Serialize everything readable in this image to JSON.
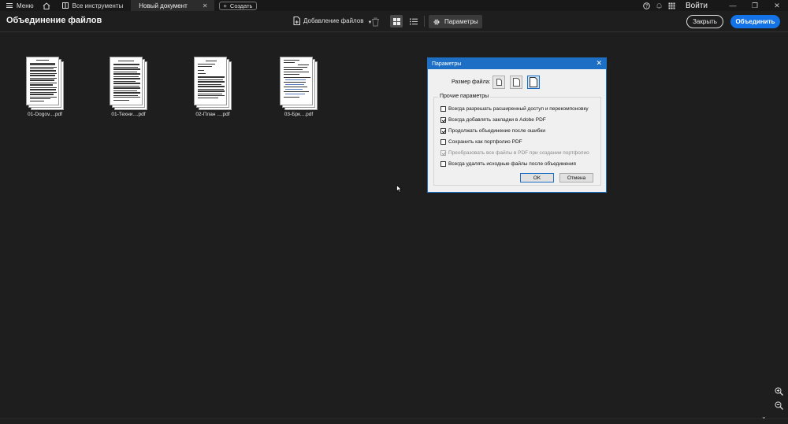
{
  "tabbar": {
    "menu_label": "Меню",
    "tabs": [
      {
        "label": "Все инструменты"
      },
      {
        "label": "Новый документ"
      }
    ],
    "new_label": "Создать",
    "signin_label": "Войти"
  },
  "toolbar": {
    "title": "Объединение файлов",
    "add_files_label": "Добавление файлов",
    "params_label": "Параметры",
    "close_label": "Закрыть",
    "merge_label": "Объединить"
  },
  "files": [
    {
      "name": "01-Dogov....pdf"
    },
    {
      "name": "01-Техни....pdf"
    },
    {
      "name": "02-План ....pdf"
    },
    {
      "name": "03-Брк....pdf"
    }
  ],
  "dialog": {
    "title": "Параметры",
    "file_size_label": "Размер файла:",
    "selected_size": "large",
    "other_params_label": "Прочие параметры",
    "options": [
      {
        "label": "Всегда разрешать расширенный доступ и перекомпоновку",
        "checked": false,
        "disabled": false
      },
      {
        "label": "Всегда добавлять закладки в Adobe PDF",
        "checked": true,
        "disabled": false
      },
      {
        "label": "Продолжать объединение после ошибки",
        "checked": true,
        "disabled": false
      },
      {
        "label": "Сохранить как портфолио PDF",
        "checked": false,
        "disabled": false
      },
      {
        "label": "Преобразовать все файлы в PDF при создании портфолио",
        "checked": true,
        "disabled": true
      },
      {
        "label": "Всегда удалять исходные файлы после объединения",
        "checked": false,
        "disabled": false
      }
    ],
    "ok_label": "OK",
    "cancel_label": "Отмена"
  },
  "colors": {
    "accent": "#1473e6",
    "dialog_title": "#1c6fc4",
    "background": "#1e1e1e"
  }
}
